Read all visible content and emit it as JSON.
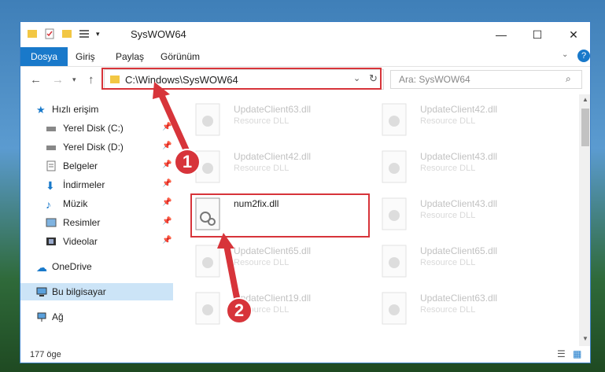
{
  "window": {
    "title": "SysWOW64",
    "minimize_icon": "minimize-icon",
    "maximize_icon": "maximize-icon",
    "close_icon": "close-icon"
  },
  "ribbon": {
    "tabs": [
      {
        "label": "Dosya",
        "active": true
      },
      {
        "label": "Giriş"
      },
      {
        "label": "Paylaş"
      },
      {
        "label": "Görünüm"
      }
    ]
  },
  "address": {
    "path": "C:\\Windows\\SysWOW64",
    "search_placeholder": "Ara: SysWOW64"
  },
  "sidebar": {
    "items": [
      {
        "label": "Hızlı erişim",
        "icon": "star-icon"
      },
      {
        "label": "Yerel Disk (C:)",
        "icon": "drive-icon",
        "pinned": true
      },
      {
        "label": "Yerel Disk (D:)",
        "icon": "drive-icon",
        "pinned": true
      },
      {
        "label": "Belgeler",
        "icon": "documents-icon",
        "pinned": true
      },
      {
        "label": "İndirmeler",
        "icon": "download-icon",
        "pinned": true
      },
      {
        "label": "Müzik",
        "icon": "music-icon",
        "pinned": true
      },
      {
        "label": "Resimler",
        "icon": "pictures-icon",
        "pinned": true
      },
      {
        "label": "Videolar",
        "icon": "videos-icon",
        "pinned": true
      },
      {
        "label": "OneDrive",
        "icon": "cloud-icon"
      },
      {
        "label": "Bu bilgisayar",
        "icon": "computer-icon",
        "selected": true
      },
      {
        "label": "Ağ",
        "icon": "network-icon"
      }
    ]
  },
  "files": {
    "left": [
      {
        "name": "UpdateClient63.dll",
        "type": "Resource DLL"
      },
      {
        "name": "UpdateClient42.dll",
        "type": "Resource DLL"
      },
      {
        "name": "num2fix.dll",
        "type": ""
      },
      {
        "name": "UpdateClient65.dll",
        "type": "Resource DLL"
      },
      {
        "name": "UpdateClient19.dll",
        "type": "Resource DLL"
      }
    ],
    "right": [
      {
        "name": "UpdateClient42.dll",
        "type": "Resource DLL"
      },
      {
        "name": "UpdateClient43.dll",
        "type": "Resource DLL"
      },
      {
        "name": "UpdateClient43.dll",
        "type": "Resource DLL"
      },
      {
        "name": "UpdateClient65.dll",
        "type": "Resource DLL"
      },
      {
        "name": "UpdateClient63.dll",
        "type": "Resource DLL"
      }
    ]
  },
  "status": {
    "count": "177 öge"
  },
  "callouts": [
    "1",
    "2"
  ],
  "colors": {
    "accent": "#1979ca",
    "highlight": "#d7343a",
    "selected": "#cce4f7"
  }
}
